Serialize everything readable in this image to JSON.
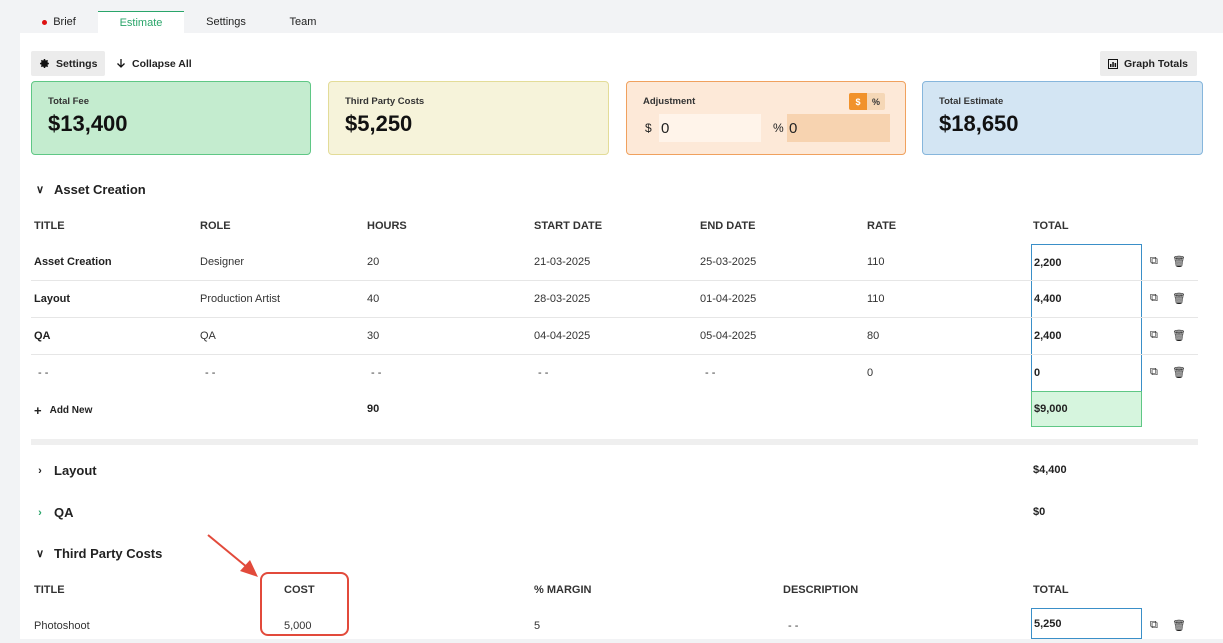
{
  "tabs": [
    {
      "label": "Brief"
    },
    {
      "label": "Estimate"
    },
    {
      "label": "Settings"
    },
    {
      "label": "Team"
    }
  ],
  "toolbar": {
    "settings_label": "Settings",
    "collapse_label": "Collapse All",
    "graph_label": "Graph Totals"
  },
  "cards": {
    "total_fee": {
      "label": "Total Fee",
      "value": "$13,400"
    },
    "third_party": {
      "label": "Third Party Costs",
      "value": "$5,250"
    },
    "adjustment": {
      "label": "Adjustment",
      "toggle_dollar": "$",
      "toggle_percent": "%",
      "dollar_symbol": "$",
      "dollar_value": "0",
      "percent_symbol": "%",
      "percent_value": "0"
    },
    "total_estimate": {
      "label": "Total Estimate",
      "value": "$18,650"
    }
  },
  "asset_section": {
    "title": "Asset Creation",
    "headers": {
      "title": "TITLE",
      "role": "ROLE",
      "hours": "HOURS",
      "start": "START DATE",
      "end": "END DATE",
      "rate": "RATE",
      "total": "TOTAL"
    },
    "rows": [
      {
        "title": "Asset Creation",
        "role": "Designer",
        "hours": "20",
        "start": "21-03-2025",
        "end": "25-03-2025",
        "rate": "110",
        "total": "2,200"
      },
      {
        "title": "Layout",
        "role": "Production Artist",
        "hours": "40",
        "start": "28-03-2025",
        "end": "01-04-2025",
        "rate": "110",
        "total": "4,400"
      },
      {
        "title": "QA",
        "role": "QA",
        "hours": "30",
        "start": "04-04-2025",
        "end": "05-04-2025",
        "rate": "80",
        "total": "2,400"
      },
      {
        "title": "- -",
        "role": "- -",
        "hours": "- -",
        "start": "- -",
        "end": "- -",
        "rate": "0",
        "total": "0"
      }
    ],
    "add_new": "Add New",
    "hours_sum": "90",
    "total_sum": "$9,000"
  },
  "collapsed_sections": [
    {
      "title": "Layout",
      "total": "$4,400"
    },
    {
      "title": "QA",
      "total": "$0"
    }
  ],
  "third_party_section": {
    "title": "Third Party Costs",
    "headers": {
      "title": "TITLE",
      "cost": "COST",
      "margin": "% MARGIN",
      "description": "DESCRIPTION",
      "total": "TOTAL"
    },
    "rows": [
      {
        "title": "Photoshoot",
        "cost": "5,000",
        "margin": "5",
        "description": "- -",
        "total": "5,250"
      }
    ]
  },
  "colors": {
    "accent_green": "#2aa56a",
    "annotation_red": "#e24a3b",
    "total_border_blue": "#3a8fc8"
  }
}
